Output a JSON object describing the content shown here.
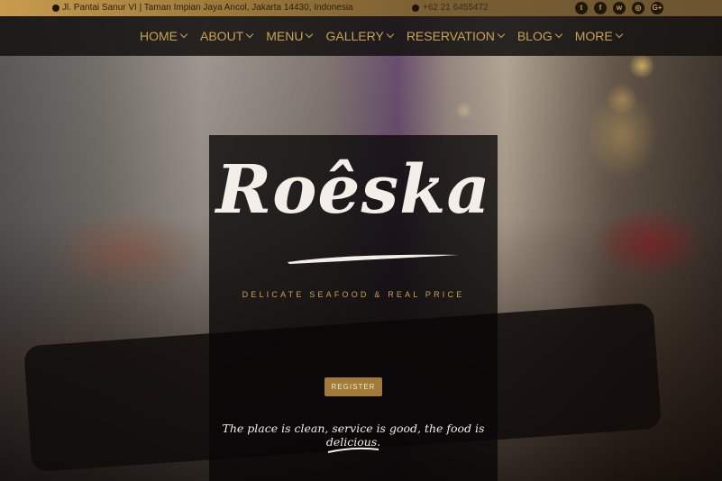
{
  "topbar": {
    "address": "Jl. Pantai Sanur VI | Taman Impian Jaya Ancol, Jakarta 14430, Indonesia",
    "phone": "+62 21 6455472",
    "social": [
      {
        "icon": "twitter-icon",
        "glyph": "t"
      },
      {
        "icon": "facebook-icon",
        "glyph": "f"
      },
      {
        "icon": "whatsapp-icon",
        "glyph": "w"
      },
      {
        "icon": "instagram-icon",
        "glyph": "◎"
      },
      {
        "icon": "google-plus-icon",
        "glyph": "G+"
      }
    ]
  },
  "nav": {
    "items": [
      "HOME",
      "ABOUT",
      "MENU",
      "GALLERY",
      "RESERVATION",
      "BLOG",
      "MORE"
    ]
  },
  "hero": {
    "logo": "Roêska",
    "tagline": "DELICATE SEAFOOD & REAL PRICE",
    "register_label": "REGISTER",
    "quote": "The place is clean, service is good, the food is delicious."
  },
  "colors": {
    "gold": "#c9a256",
    "topbar_gold": "#c79c4e",
    "button": "#a17a38",
    "nav_bg": "#141211"
  }
}
